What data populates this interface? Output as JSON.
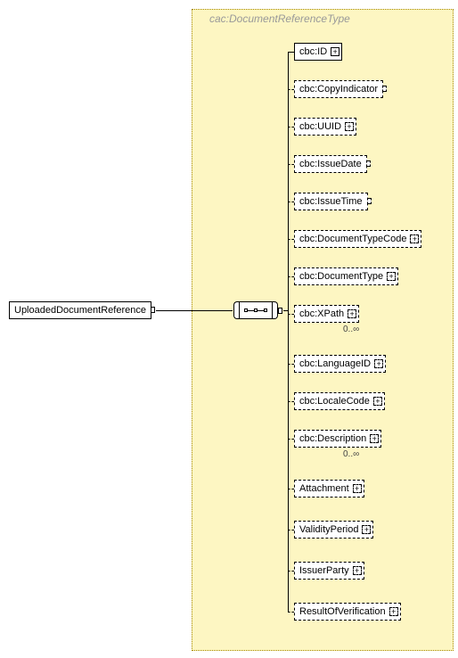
{
  "type_label": "cac:DocumentReferenceType",
  "root": {
    "label": "UploadedDocumentReference"
  },
  "children": [
    {
      "key": "id",
      "label": "cbc:ID",
      "style": "solid",
      "plus": true,
      "card": null
    },
    {
      "key": "copy",
      "label": "cbc:CopyIndicator",
      "style": "dashed",
      "plus": false,
      "card": null
    },
    {
      "key": "uuid",
      "label": "cbc:UUID",
      "style": "dashed",
      "plus": true,
      "card": null
    },
    {
      "key": "issuedate",
      "label": "cbc:IssueDate",
      "style": "dashed",
      "plus": false,
      "card": null
    },
    {
      "key": "issuetime",
      "label": "cbc:IssueTime",
      "style": "dashed",
      "plus": false,
      "card": null
    },
    {
      "key": "dtc",
      "label": "cbc:DocumentTypeCode",
      "style": "dashed",
      "plus": true,
      "card": null
    },
    {
      "key": "dt",
      "label": "cbc:DocumentType",
      "style": "dashed",
      "plus": true,
      "card": null
    },
    {
      "key": "xpath",
      "label": "cbc:XPath",
      "style": "dashed",
      "plus": true,
      "card": "0..∞"
    },
    {
      "key": "lang",
      "label": "cbc:LanguageID",
      "style": "dashed",
      "plus": true,
      "card": null
    },
    {
      "key": "locale",
      "label": "cbc:LocaleCode",
      "style": "dashed",
      "plus": true,
      "card": null
    },
    {
      "key": "desc",
      "label": "cbc:Description",
      "style": "dashed",
      "plus": true,
      "card": "0..∞"
    },
    {
      "key": "attach",
      "label": "Attachment",
      "style": "dashed",
      "plus": true,
      "card": null
    },
    {
      "key": "valid",
      "label": "ValidityPeriod",
      "style": "dashed",
      "plus": true,
      "card": null
    },
    {
      "key": "issuer",
      "label": "IssuerParty",
      "style": "dashed",
      "plus": true,
      "card": null
    },
    {
      "key": "rov",
      "label": "ResultOfVerification",
      "style": "dashed",
      "plus": true,
      "card": null
    }
  ],
  "chart_data": {
    "type": "diagram",
    "root": "UploadedDocumentReference",
    "complexType": "cac:DocumentReferenceType",
    "compositor": "sequence",
    "children": [
      {
        "name": "cbc:ID",
        "required": true,
        "expandable": true,
        "minOccurs": 1,
        "maxOccurs": 1
      },
      {
        "name": "cbc:CopyIndicator",
        "required": false,
        "expandable": false,
        "minOccurs": 0,
        "maxOccurs": 1
      },
      {
        "name": "cbc:UUID",
        "required": false,
        "expandable": true,
        "minOccurs": 0,
        "maxOccurs": 1
      },
      {
        "name": "cbc:IssueDate",
        "required": false,
        "expandable": false,
        "minOccurs": 0,
        "maxOccurs": 1
      },
      {
        "name": "cbc:IssueTime",
        "required": false,
        "expandable": false,
        "minOccurs": 0,
        "maxOccurs": 1
      },
      {
        "name": "cbc:DocumentTypeCode",
        "required": false,
        "expandable": true,
        "minOccurs": 0,
        "maxOccurs": 1
      },
      {
        "name": "cbc:DocumentType",
        "required": false,
        "expandable": true,
        "minOccurs": 0,
        "maxOccurs": 1
      },
      {
        "name": "cbc:XPath",
        "required": false,
        "expandable": true,
        "minOccurs": 0,
        "maxOccurs": "unbounded"
      },
      {
        "name": "cbc:LanguageID",
        "required": false,
        "expandable": true,
        "minOccurs": 0,
        "maxOccurs": 1
      },
      {
        "name": "cbc:LocaleCode",
        "required": false,
        "expandable": true,
        "minOccurs": 0,
        "maxOccurs": 1
      },
      {
        "name": "cbc:Description",
        "required": false,
        "expandable": true,
        "minOccurs": 0,
        "maxOccurs": "unbounded"
      },
      {
        "name": "Attachment",
        "required": false,
        "expandable": true,
        "minOccurs": 0,
        "maxOccurs": 1
      },
      {
        "name": "ValidityPeriod",
        "required": false,
        "expandable": true,
        "minOccurs": 0,
        "maxOccurs": 1
      },
      {
        "name": "IssuerParty",
        "required": false,
        "expandable": true,
        "minOccurs": 0,
        "maxOccurs": 1
      },
      {
        "name": "ResultOfVerification",
        "required": false,
        "expandable": true,
        "minOccurs": 0,
        "maxOccurs": 1
      }
    ]
  }
}
